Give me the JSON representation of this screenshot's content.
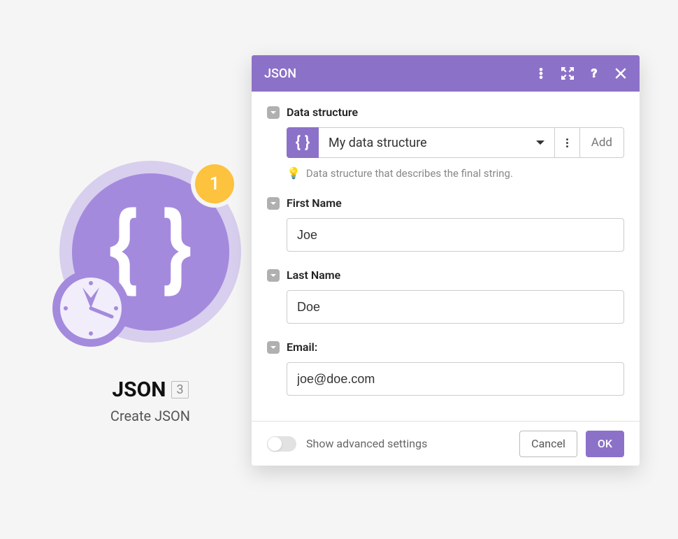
{
  "module": {
    "title": "JSON",
    "subtitle": "Create JSON",
    "counter": "1",
    "side_badge": "3"
  },
  "panel": {
    "title": "JSON"
  },
  "ds": {
    "label": "Data structure",
    "selected": "My data structure",
    "add_label": "Add",
    "helper": "Data structure that describes the final string."
  },
  "fields": {
    "first_name": {
      "label": "First Name",
      "value": "Joe"
    },
    "last_name": {
      "label": "Last Name",
      "value": "Doe"
    },
    "email": {
      "label": "Email:",
      "value": "joe@doe.com"
    }
  },
  "footer": {
    "advanced": "Show advanced settings",
    "cancel": "Cancel",
    "ok": "OK"
  }
}
